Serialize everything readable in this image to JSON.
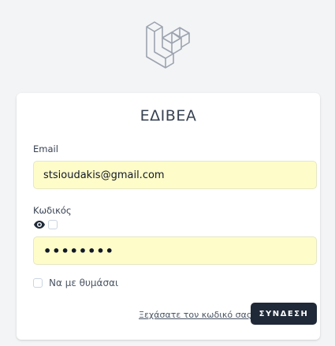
{
  "brand": {
    "logo_icon": "laravel-logo-icon"
  },
  "login": {
    "title": "ΕΔΙΒΕΑ",
    "email_label": "Email",
    "email_value": "stsioudakis@gmail.com",
    "password_label": "Κωδικός",
    "password_value": "••••••••",
    "show_password_icon": "eye-icon",
    "remember_label": "Να με θυμάσαι",
    "forgot_link": "Ξεχάσατε τον κωδικό σας;",
    "submit_label": "ΣΥΝΔΕΣΗ"
  }
}
